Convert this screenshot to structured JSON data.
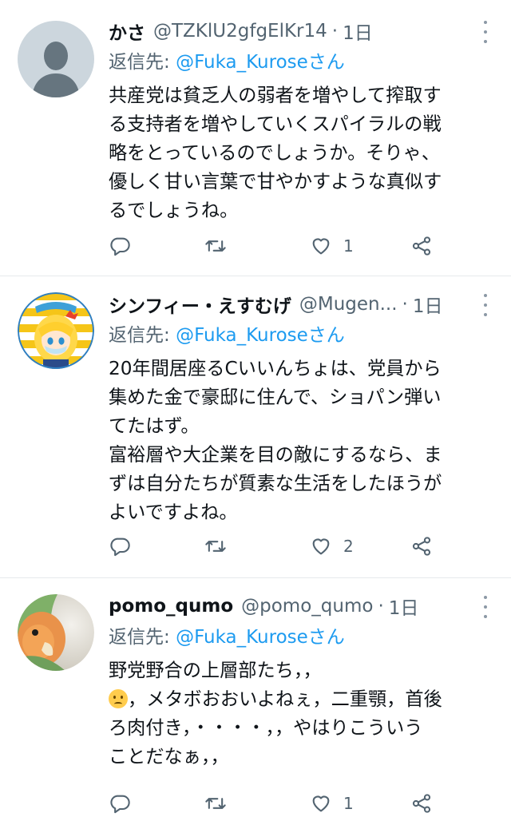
{
  "tweets": [
    {
      "name": "かさ",
      "handle": "@TZKlU2gfgElKr14",
      "time": "1日",
      "reply_prefix": "返信先: ",
      "reply_to": "@Fuka_Kuroseさん",
      "lines": [
        "共産党は貧乏人の弱者を増やして搾取す",
        "る支持者を増やしていくスパイラルの戦",
        "略をとっているのでしょうか。そりゃ、",
        "優しく甘い言葉で甘やかすような真似す",
        "るでしょうね。"
      ],
      "likes": "1",
      "avatar": "default-avatar-icon"
    },
    {
      "name": "シンフィー・えすむげ",
      "handle": "@Mugen...",
      "time": "1日",
      "reply_prefix": "返信先: ",
      "reply_to": "@Fuka_Kuroseさん",
      "lines": [
        "20年間居座るCいいんちょは、党員から",
        "集めた金で豪邸に住んで、ショパン弾い",
        "てたはず。",
        "富裕層や大企業を目の敵にするなら、ま",
        "ずは自分たちが質素な生活をしたほうが",
        "よいですよね。"
      ],
      "likes": "2",
      "avatar": "anime-character-avatar"
    },
    {
      "name": "pomo_qumo",
      "handle": "@pomo_qumo",
      "time": "1日",
      "reply_prefix": "返信先: ",
      "reply_to": "@Fuka_Kuroseさん",
      "line1": "野党野合の上層部たち，，",
      "line2": "，メタボおおいよねぇ，二重顎，首後",
      "line3": "ろ肉付き，・・・・，，やはりこういう",
      "line4": "ことだなぁ，，",
      "emoji": "frowning-face-emoji",
      "likes": "1",
      "avatar": "parrot-photo-avatar"
    }
  ],
  "colors": {
    "text": "#0f1419",
    "secondary": "#536471",
    "link": "#1d9bf0",
    "divider": "#e6e9ec"
  }
}
